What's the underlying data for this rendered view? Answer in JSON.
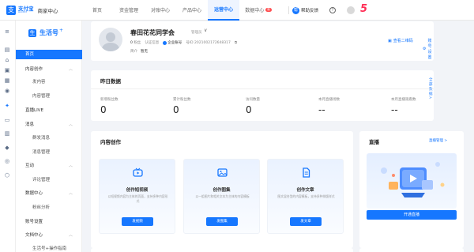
{
  "topbar": {
    "logo_glyph": "支",
    "logo_main": "支付宝",
    "logo_sub": "ALIPAY",
    "logo_center": "商家中心",
    "nav": [
      {
        "label": "首页"
      },
      {
        "label": "资金管理"
      },
      {
        "label": "对账中心"
      },
      {
        "label": "产品中心"
      },
      {
        "label": "运营中心"
      },
      {
        "label": "数据中心"
      }
    ],
    "new_badge": "新",
    "feedback_label": "帮助反馈",
    "feedback_glyph": "帮",
    "help_glyph": "?",
    "brand_mark": "5"
  },
  "sidebar": {
    "brand_glyph": "生",
    "brand": "生活号",
    "brand_plus": "+",
    "items": [
      {
        "label": "首页"
      },
      {
        "label": "内容创作"
      },
      {
        "label": "发内容"
      },
      {
        "label": "内容管理"
      },
      {
        "label": "直播LIVE"
      },
      {
        "label": "消息"
      },
      {
        "label": "群发消息"
      },
      {
        "label": "消息管理"
      },
      {
        "label": "互动"
      },
      {
        "label": "评论管理"
      },
      {
        "label": "数据中心"
      },
      {
        "label": "粉丝分析"
      },
      {
        "label": "账号设置"
      },
      {
        "label": "文档中心"
      },
      {
        "label": "生活号+操作指南"
      }
    ]
  },
  "profile": {
    "name": "春田花花同学会",
    "admin": "管理员",
    "switch_glyph": "∨",
    "fans": "0",
    "fans_label": "粉丝",
    "cert_label": "认证信息",
    "enterprise_label": "企业账号",
    "id_label": "号ID",
    "id_value": "2021002172648317",
    "copy_glyph": "⧉",
    "intro_label": "简介",
    "intro_value": "暂无",
    "qr_label": "查看二维码",
    "settings_label": "账号设置",
    "qr_glyph": "▣",
    "settings_glyph": "⚙"
  },
  "yesterday": {
    "title": "昨日数据",
    "more": "全部数据 >",
    "stats": [
      {
        "label": "新增粉丝数",
        "value": "0"
      },
      {
        "label": "累计粉丝数",
        "value": "0"
      },
      {
        "label": "访问数量",
        "value": "0"
      },
      {
        "label": "本月直播场数",
        "value": "--"
      },
      {
        "label": "本月直播观看数",
        "value": "--"
      }
    ]
  },
  "create": {
    "title": "内容创作",
    "tiles": [
      {
        "title": "创作短视频",
        "desc": "以短视频内容为主体的页面，支持多种内容形式",
        "button": "发视频"
      },
      {
        "title": "创作图集",
        "desc": "以一组图片和相关文本为主体的内容模板",
        "button": "发图集"
      },
      {
        "title": "创作文章",
        "desc": "图文混合型的内容模板，支持多种排版样式",
        "button": "发文章"
      }
    ]
  },
  "live": {
    "title": "直播",
    "more": "直播管理 >",
    "button": "开通直播"
  },
  "colors": {
    "accent": "#1677ff",
    "badge": "#ff4d4f",
    "brand_mark": "#ff2d55"
  }
}
